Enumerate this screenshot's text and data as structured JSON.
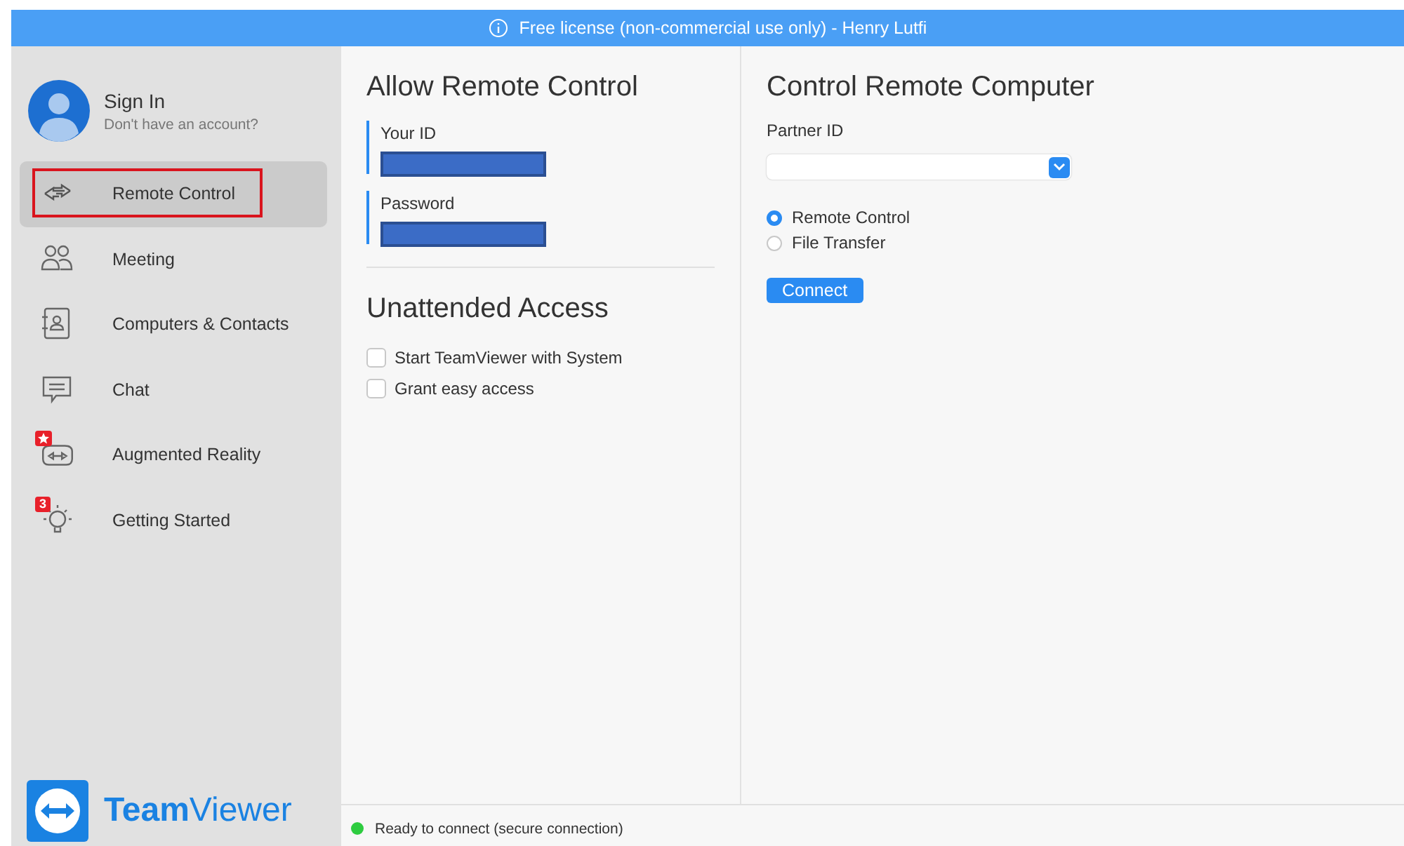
{
  "banner": {
    "text": "Free license (non-commercial use only) - Henry Lutfi"
  },
  "account": {
    "title": "Sign In",
    "subtitle": "Don't have an account?"
  },
  "nav": [
    {
      "label": "Remote Control",
      "kind": "arrows",
      "selected": true,
      "outlined": true
    },
    {
      "label": "Meeting",
      "kind": "people",
      "selected": false,
      "outlined": false
    },
    {
      "label": "Computers & Contacts",
      "kind": "contacts",
      "selected": false,
      "outlined": false
    },
    {
      "label": "Chat",
      "kind": "chat",
      "selected": false,
      "outlined": false
    },
    {
      "label": "Augmented Reality",
      "kind": "ar",
      "selected": false,
      "outlined": false
    },
    {
      "label": "Getting Started",
      "kind": "bulb",
      "selected": false,
      "outlined": false,
      "badge": "3"
    }
  ],
  "logo": {
    "text": "**Team**Viewer"
  },
  "allow": {
    "title": "Allow Remote Control",
    "fields": [
      {
        "label": "Your ID"
      },
      {
        "label": "Password"
      }
    ]
  },
  "unattended": {
    "title": "Unattended Access",
    "options": [
      {
        "label": "Start TeamViewer with System",
        "checked": false
      },
      {
        "label": "Grant easy access",
        "checked": false
      }
    ]
  },
  "control": {
    "title": "Control Remote Computer",
    "partner_label": "Partner ID",
    "modes": [
      {
        "label": "Remote Control",
        "selected": true
      },
      {
        "label": "File Transfer",
        "selected": false
      }
    ],
    "button": "Connect"
  },
  "status": {
    "text": "Ready to connect (secure connection)",
    "color": "#2ecc40"
  }
}
